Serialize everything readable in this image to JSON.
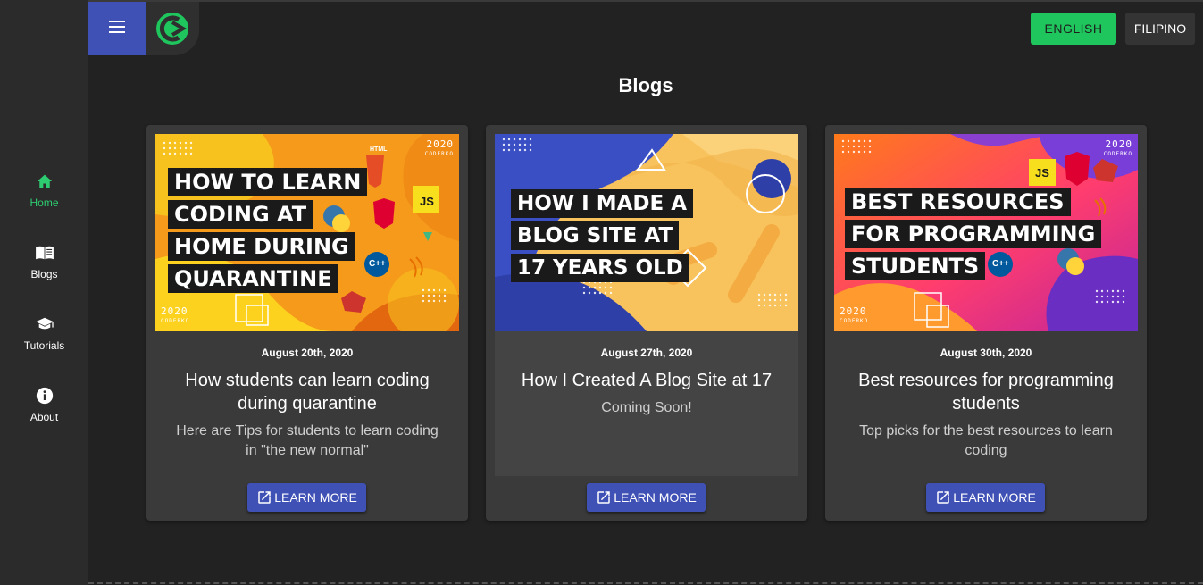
{
  "sidebar": {
    "items": [
      {
        "label": "Home",
        "icon": "home-icon",
        "active": true
      },
      {
        "label": "Blogs",
        "icon": "book-icon"
      },
      {
        "label": "Tutorials",
        "icon": "graduation-cap-icon"
      },
      {
        "label": "About",
        "icon": "info-icon"
      }
    ]
  },
  "header": {
    "lang_english": "ENGLISH",
    "lang_filipino": "FILIPINO",
    "accent": "#1fc55d",
    "primary": "#3f51b5"
  },
  "main": {
    "title": "Blogs",
    "cards": [
      {
        "date": "August 20th, 2020",
        "title": "How students can learn coding during quarantine",
        "desc": "Here are Tips for students to learn coding in \"the new normal\"",
        "button": "LEARN MORE",
        "thumb_lines": [
          "HOW TO LEARN",
          "CODING AT",
          "HOME DURING",
          "QUARANTINE"
        ],
        "thumb_year": "2020",
        "thumb_brand": "CODERKO",
        "thumb_badges": [
          "HTML",
          "JS",
          "C++"
        ]
      },
      {
        "date": "August 27th, 2020",
        "title": "How I Created A Blog Site at 17",
        "desc": "Coming Soon!",
        "button": "LEARN MORE",
        "thumb_lines": [
          "HOW I MADE A",
          "BLOG SITE AT",
          "17 YEARS OLD"
        ]
      },
      {
        "date": "August 30th, 2020",
        "title": "Best resources for programming students",
        "desc": "Top picks for the best resources to learn coding",
        "button": "LEARN MORE",
        "thumb_lines": [
          "BEST RESOURCES",
          "FOR PROGRAMMING",
          "STUDENTS"
        ],
        "thumb_year": "2020",
        "thumb_brand": "CODERKO",
        "thumb_badges": [
          "JS",
          "C++"
        ]
      }
    ]
  }
}
